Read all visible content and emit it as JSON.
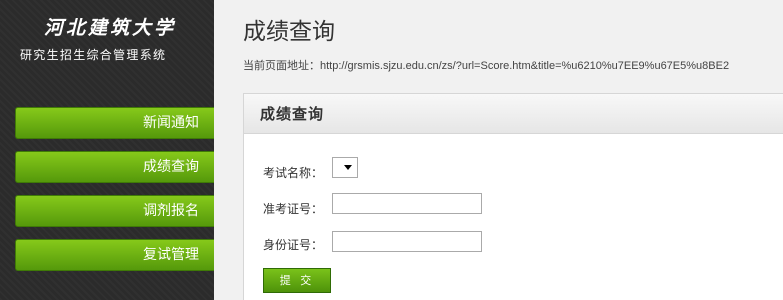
{
  "sidebar": {
    "logo_title": "河北建筑大学",
    "logo_subtitle": "研究生招生综合管理系统",
    "items": [
      {
        "label": "新闻通知"
      },
      {
        "label": "成绩查询"
      },
      {
        "label": "调剂报名"
      },
      {
        "label": "复试管理"
      }
    ]
  },
  "main": {
    "page_title": "成绩查询",
    "url_label": "当前页面地址：",
    "url_value": "http://grsmis.sjzu.edu.cn/zs/?url=Score.htm&title=%u6210%u7EE9%u67E5%u8BE2",
    "panel_title": "成绩查询",
    "form": {
      "exam_name_label": "考试名称：",
      "exam_name_value": "",
      "ticket_label": "准考证号：",
      "ticket_value": "",
      "id_label": "身份证号：",
      "id_value": "",
      "submit_label": "提 交"
    }
  },
  "colors": {
    "sidebar_bg": "#2b2b2b",
    "accent_green": "#6cb012",
    "page_bg": "#f1f1f1"
  }
}
